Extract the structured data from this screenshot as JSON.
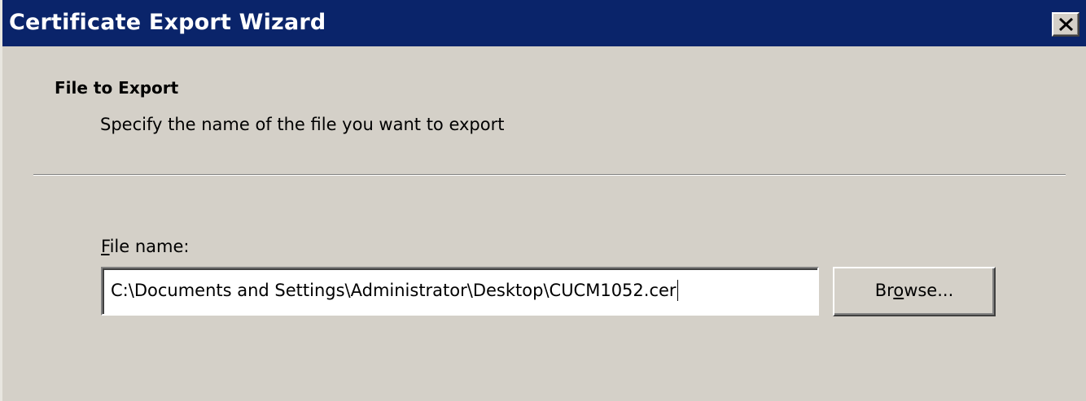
{
  "window": {
    "title": "Certificate Export Wizard",
    "close_icon": "close-icon",
    "title_bar_color": "#0a246a",
    "background_color": "#d4d0c8"
  },
  "page": {
    "heading": "File to Export",
    "subheading": "Specify the name of the file you want to export"
  },
  "file_field": {
    "label_prefix": "F",
    "label_rest": "ile name:",
    "value": "C:\\Documents and Settings\\Administrator\\Desktop\\CUCM1052.cer"
  },
  "browse_button": {
    "label_prefix": "Br",
    "label_mnemonic": "o",
    "label_rest": "wse..."
  }
}
